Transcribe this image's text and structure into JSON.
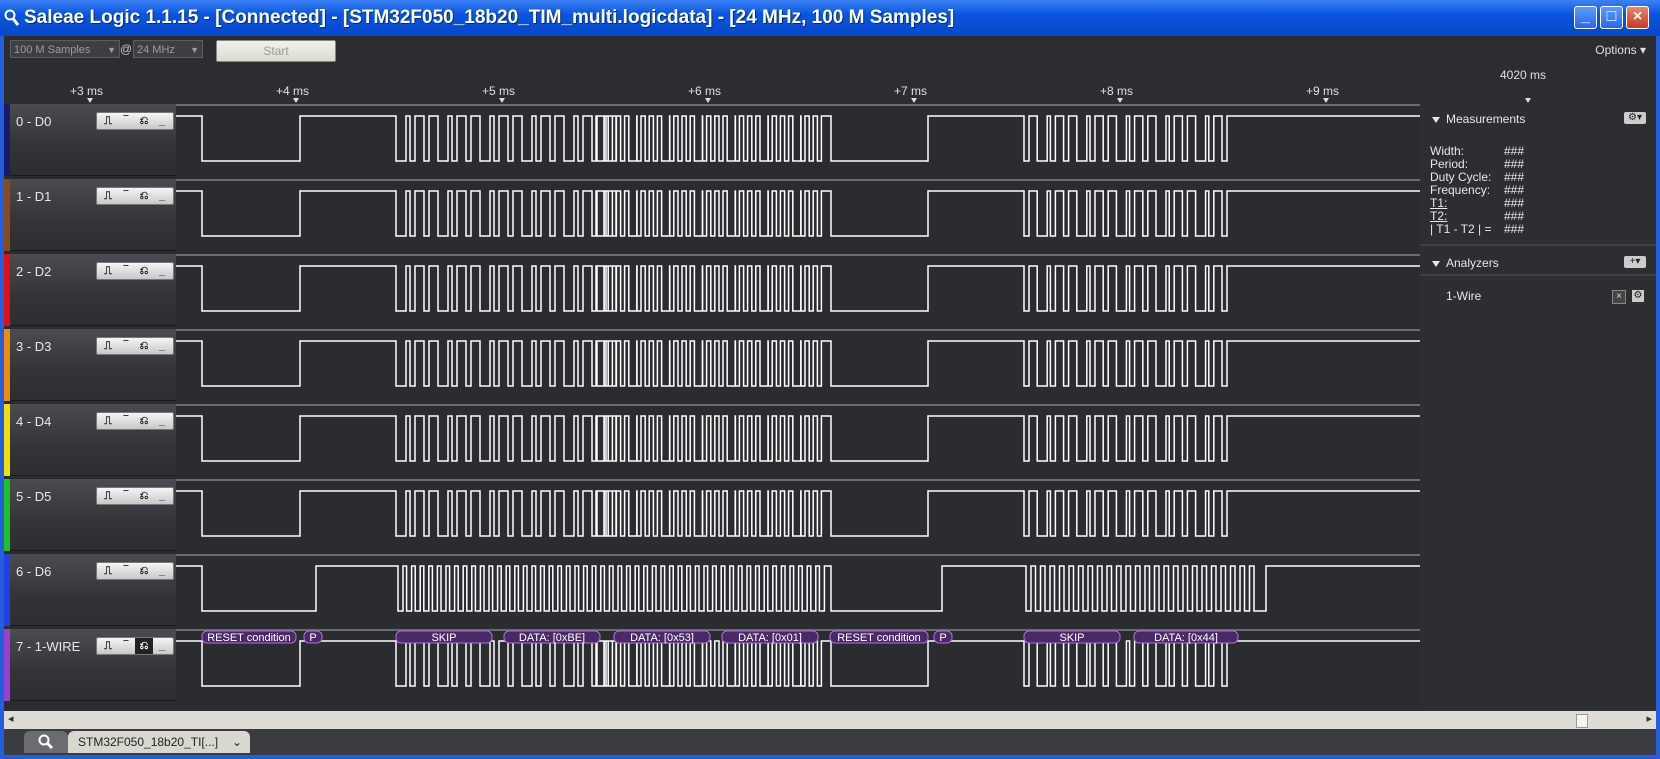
{
  "window": {
    "title": "Saleae Logic 1.1.15 - [Connected] - [STM32F050_18b20_TIM_multi.logicdata] - [24 MHz, 100 M Samples]",
    "minimize": "_",
    "maximize": "□",
    "close": "×"
  },
  "toolbar": {
    "samples": "100 M Samples",
    "at": "@",
    "rate": "24 MHz",
    "start_label": "Start",
    "options_label": "Options"
  },
  "ruler": {
    "ticks": [
      "+3 ms",
      "+4 ms",
      "+5 ms",
      "+6 ms",
      "+7 ms",
      "+8 ms",
      "+9 ms"
    ],
    "cursor_label": "4020 ms"
  },
  "channels": [
    {
      "label": "0 - D0",
      "color": "#1a1a6a"
    },
    {
      "label": "1 - D1",
      "color": "#8b4a1a"
    },
    {
      "label": "2 - D2",
      "color": "#e01010"
    },
    {
      "label": "3 - D3",
      "color": "#f08a10"
    },
    {
      "label": "4 - D4",
      "color": "#f0e010"
    },
    {
      "label": "5 - D5",
      "color": "#20c020"
    },
    {
      "label": "6 - D6",
      "color": "#2040e0"
    },
    {
      "label": "7 - 1-WIRE",
      "color": "#9a40d0"
    }
  ],
  "decoder": [
    {
      "text": "RESET condition"
    },
    {
      "text": "P"
    },
    {
      "text": "SKIP"
    },
    {
      "text": "DATA: [0xBE]"
    },
    {
      "text": "DATA: [0x53]"
    },
    {
      "text": "DATA: [0x01]"
    },
    {
      "text": "RESET condition"
    },
    {
      "text": "P"
    },
    {
      "text": "SKIP"
    },
    {
      "text": "DATA: [0x44]"
    }
  ],
  "measurements": {
    "title": "Measurements",
    "rows": [
      {
        "label": "Width:",
        "value": "###"
      },
      {
        "label": "Period:",
        "value": "###"
      },
      {
        "label": "Duty Cycle:",
        "value": "###"
      },
      {
        "label": "Frequency:",
        "value": "###"
      },
      {
        "label": "T1:",
        "value": "###"
      },
      {
        "label": "T2:",
        "value": "###"
      },
      {
        "label": "| T1 - T2 | =",
        "value": "###"
      }
    ]
  },
  "analyzers": {
    "title": "Analyzers",
    "items": [
      "1-Wire"
    ]
  },
  "tabs": {
    "file": "STM32F050_18b20_TI[...]"
  }
}
